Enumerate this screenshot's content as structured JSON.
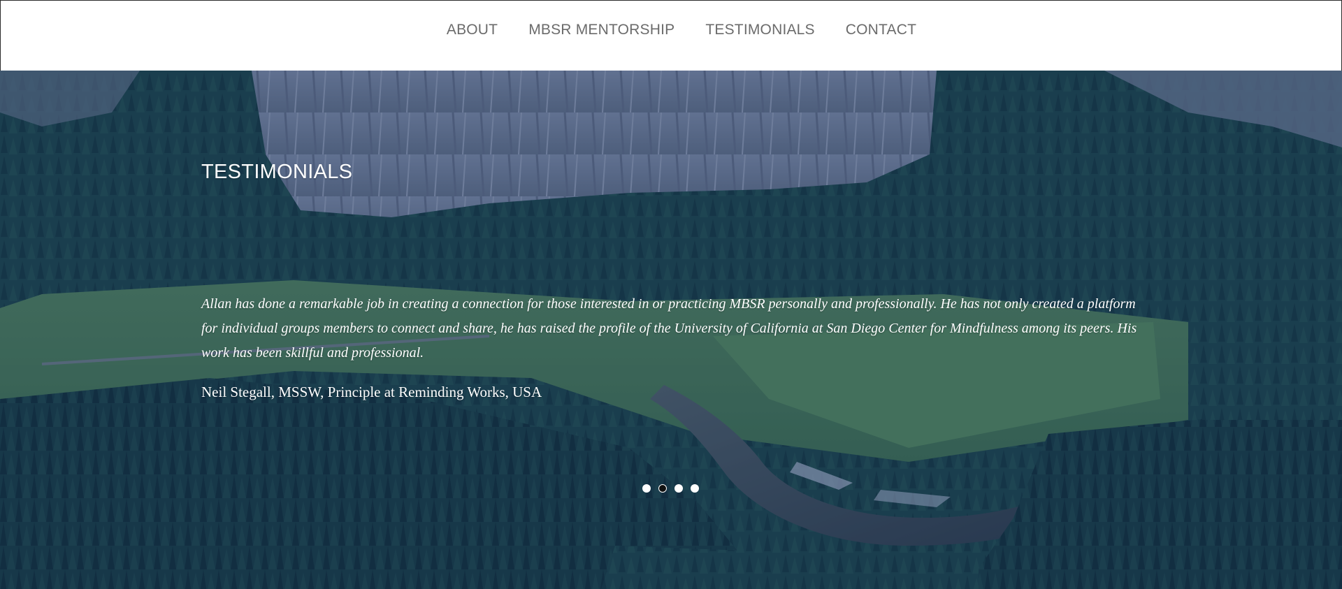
{
  "nav": {
    "items": [
      {
        "label": "ABOUT"
      },
      {
        "label": "MBSR MENTORSHIP"
      },
      {
        "label": "TESTIMONIALS"
      },
      {
        "label": "CONTACT"
      }
    ]
  },
  "testimonials": {
    "title": "TESTIMONIALS",
    "quote": "Allan has done a remarkable job in creating a connection for those interested in or practicing MBSR personally and professionally. He has not only created a platform for individual groups members to connect and share, he has raised the profile of the University of California at San Diego Center for Mindfulness among its peers. His work has been skillful and professional.",
    "author": "Neil Stegall, MSSW, Principle at Reminding Works, USA",
    "slider": {
      "total": 4,
      "active_index": 2
    }
  },
  "colors": {
    "nav_text": "#6b6b6b",
    "overlay_tint": "#182c6e",
    "forest_dark": "#163a33",
    "meadow": "#4f8a4a",
    "cliff": "#8c99a3",
    "text_light": "#ffffff"
  }
}
